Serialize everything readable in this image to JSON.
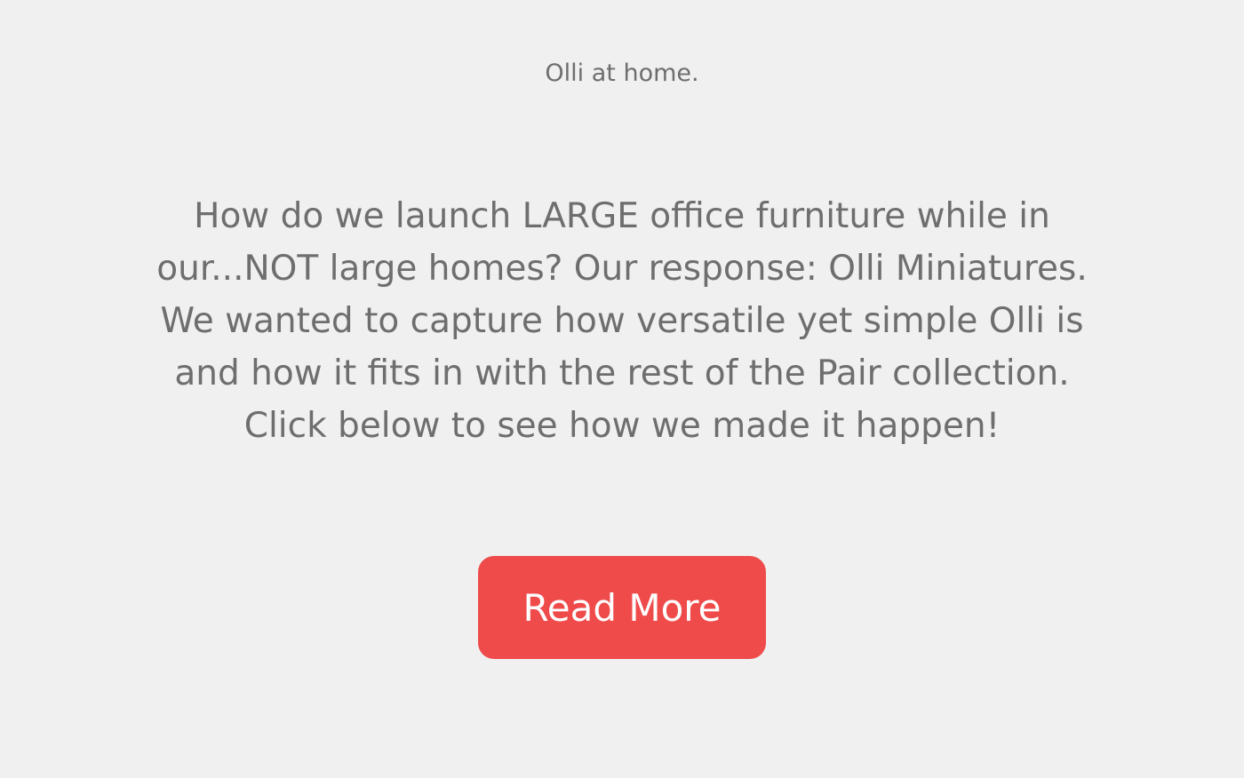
{
  "caption": "Olli at home.",
  "description": "How do we launch LARGE office furniture while in our...NOT large homes? Our response: Olli Miniatures. We wanted to capture how versatile yet simple Olli is and how it fits in with the rest of the Pair collection. Click below to see how we made it happen!",
  "cta": {
    "label": "Read More"
  },
  "colors": {
    "background": "#f0f0f0",
    "text": "#6e6e6e",
    "accent": "#ef4b4b",
    "button_text": "#ffffff"
  }
}
